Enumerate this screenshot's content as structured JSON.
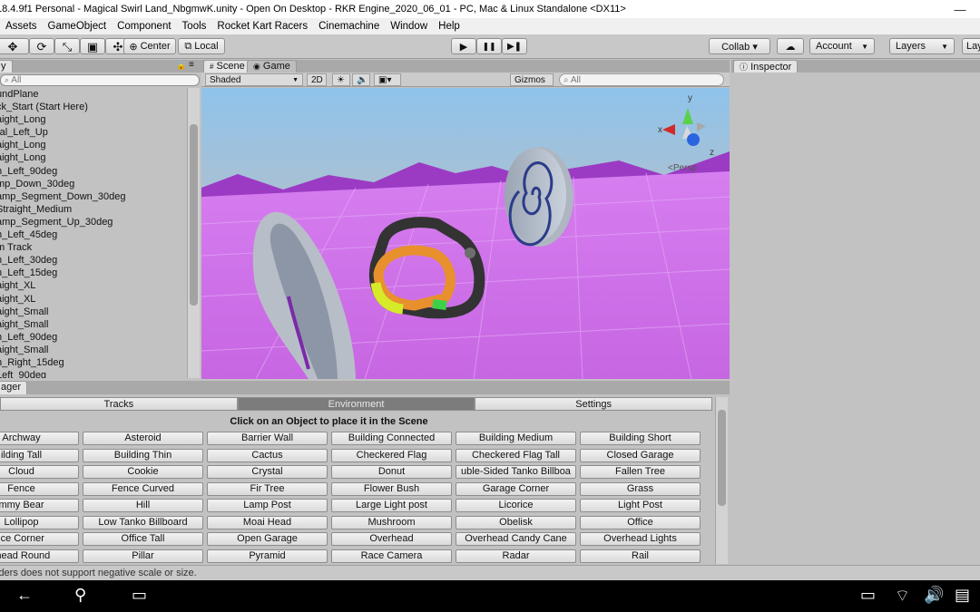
{
  "titlebar": {
    "title": "18.4.9f1 Personal - Magical Swirl Land_NbgmwK.unity - Open On Desktop - RKR Engine_2020_06_01 - PC, Mac & Linux Standalone <DX11>",
    "minimize": "—",
    "maximize": "☐"
  },
  "menu": [
    "Assets",
    "GameObject",
    "Component",
    "Tools",
    "Rocket Kart Racers",
    "Cinemachine",
    "Window",
    "Help"
  ],
  "toolbar": {
    "pivot": "Center",
    "space": "Local",
    "play": "▶",
    "pause": "❚❚",
    "step": "▶❚",
    "collab": "Collab ▾",
    "cloud": "☁",
    "account": "Account",
    "layers": "Layers",
    "layout": "Lay"
  },
  "hierarchy": {
    "tab": "y",
    "search_placeholder": "All",
    "items": [
      "undPlane",
      "ck_Start (Start Here)",
      "aight_Long",
      "ral_Left_Up",
      "aight_Long",
      "aight_Long",
      "n_Left_90deg",
      "mp_Down_30deg",
      "amp_Segment_Down_30deg",
      "Straight_Medium",
      "amp_Segment_Up_30deg",
      "n_Left_45deg",
      "m Track",
      "n_Left_30deg",
      "n_Left_15deg",
      "aight_XL",
      "aight_XL",
      "aight_Small",
      "aight_Small",
      "n_Left_90deg",
      "aight_Small",
      "n_Right_15deg",
      "Left_90deg"
    ]
  },
  "scene": {
    "tab_scene": "Scene",
    "tab_game": "Game",
    "shading": "Shaded",
    "mode_2d": "2D",
    "gizmos": "Gizmos",
    "search_placeholder": "All",
    "persp_label": "Persp",
    "gizmo_axis_y": "y",
    "gizmo_axis_x": "x",
    "gizmo_axis_z": "z"
  },
  "inspector": {
    "tab": "Inspector"
  },
  "manager": {
    "tab": "ager",
    "tabs": [
      "Tracks",
      "Environment",
      "Settings"
    ],
    "active_tab": "Environment",
    "instruction": "Click on an Object to place it in the Scene",
    "buttons": [
      [
        "Archway",
        "Asteroid",
        "Barrier Wall",
        "Building Connected",
        "Building Medium",
        "Building Short"
      ],
      [
        "ilding Tall",
        "Building Thin",
        "Cactus",
        "Checkered Flag",
        "Checkered Flag Tall",
        "Closed Garage"
      ],
      [
        "Cloud",
        "Cookie",
        "Crystal",
        "Donut",
        "uble-Sided Tanko Billboa",
        "Fallen Tree"
      ],
      [
        "Fence",
        "Fence Curved",
        "Fir Tree",
        "Flower Bush",
        "Garage Corner",
        "Grass"
      ],
      [
        "mmy Bear",
        "Hill",
        "Lamp Post",
        "Large Light post",
        "Licorice",
        "Light Post"
      ],
      [
        "Lollipop",
        "Low Tanko Billboard",
        "Moai Head",
        "Mushroom",
        "Obelisk",
        "Office"
      ],
      [
        "ice Corner",
        "Office Tall",
        "Open Garage",
        "Overhead",
        "Overhead Candy Cane",
        "Overhead Lights"
      ],
      [
        "rhead Round",
        "Pillar",
        "Pyramid",
        "Race Camera",
        "Radar",
        "Rail"
      ]
    ]
  },
  "status": {
    "message": "lders does not support negative scale or size."
  },
  "colors": {
    "sky_top": "#8fc3ea",
    "ground": "#cc72e6",
    "mountains": "#9b3bc4",
    "active_tab": "#7c7c7c"
  }
}
